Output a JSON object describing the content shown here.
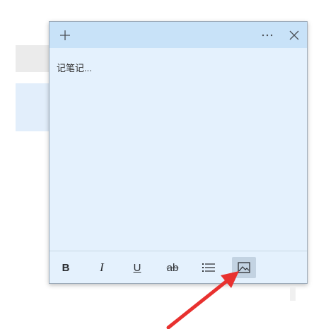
{
  "note": {
    "add_icon": "plus-icon",
    "more_icon": "ellipsis-icon",
    "close_icon": "close-icon",
    "body_text": "记笔记..."
  },
  "toolbar": {
    "bold_label": "B",
    "italic_label": "I",
    "underline_label": "U",
    "strike_label": "ab",
    "list_icon": "bullet-list-icon",
    "image_icon": "image-icon"
  },
  "colors": {
    "note_bg": "#e4f1fd",
    "header_bg": "#c8e2f8",
    "arrow": "#e8312f"
  }
}
